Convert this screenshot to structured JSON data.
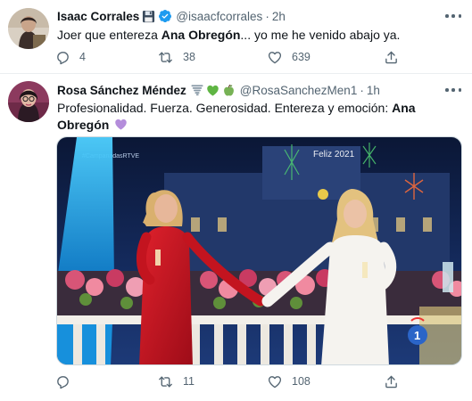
{
  "tweets": [
    {
      "name": "Isaac Corrales",
      "badge": "💾",
      "handle": "@isaacfcorrales",
      "separator": "·",
      "time": "2h",
      "text_before": "Joer que entereza ",
      "text_bold": "Ana Obregón",
      "text_after": "... yo me he venido abajo ya.",
      "replies": "4",
      "retweets": "38",
      "likes": "639"
    },
    {
      "name": "Rosa Sánchez Méndez",
      "handle": "@RosaSanchezMen1",
      "separator": "·",
      "time": "1h",
      "text_before": "Profesionalidad. Fuerza. Generosidad. Entereza y emoción: ",
      "text_bold": "Ana Obregón",
      "text_after": ".",
      "media": {
        "watermark": "#CampanadasRTVE",
        "year_label": "Feliz 2021",
        "channel_logo": "1"
      },
      "replies": "",
      "retweets": "11",
      "likes": "108"
    }
  ],
  "colors": {
    "verified": "#1d9bf0",
    "secondary_text": "#536471",
    "divider": "#ebeef0",
    "heart_purple": "#b48ddb",
    "green_heart": "#5fb543"
  },
  "icons": [
    "verified-badge-icon",
    "floppy-disk-emoji-icon",
    "tornado-emoji-icon",
    "green-heart-emoji-icon",
    "green-apple-emoji-icon",
    "purple-heart-emoji-icon",
    "reply-icon",
    "retweet-icon",
    "like-icon",
    "share-icon",
    "more-options-icon"
  ]
}
